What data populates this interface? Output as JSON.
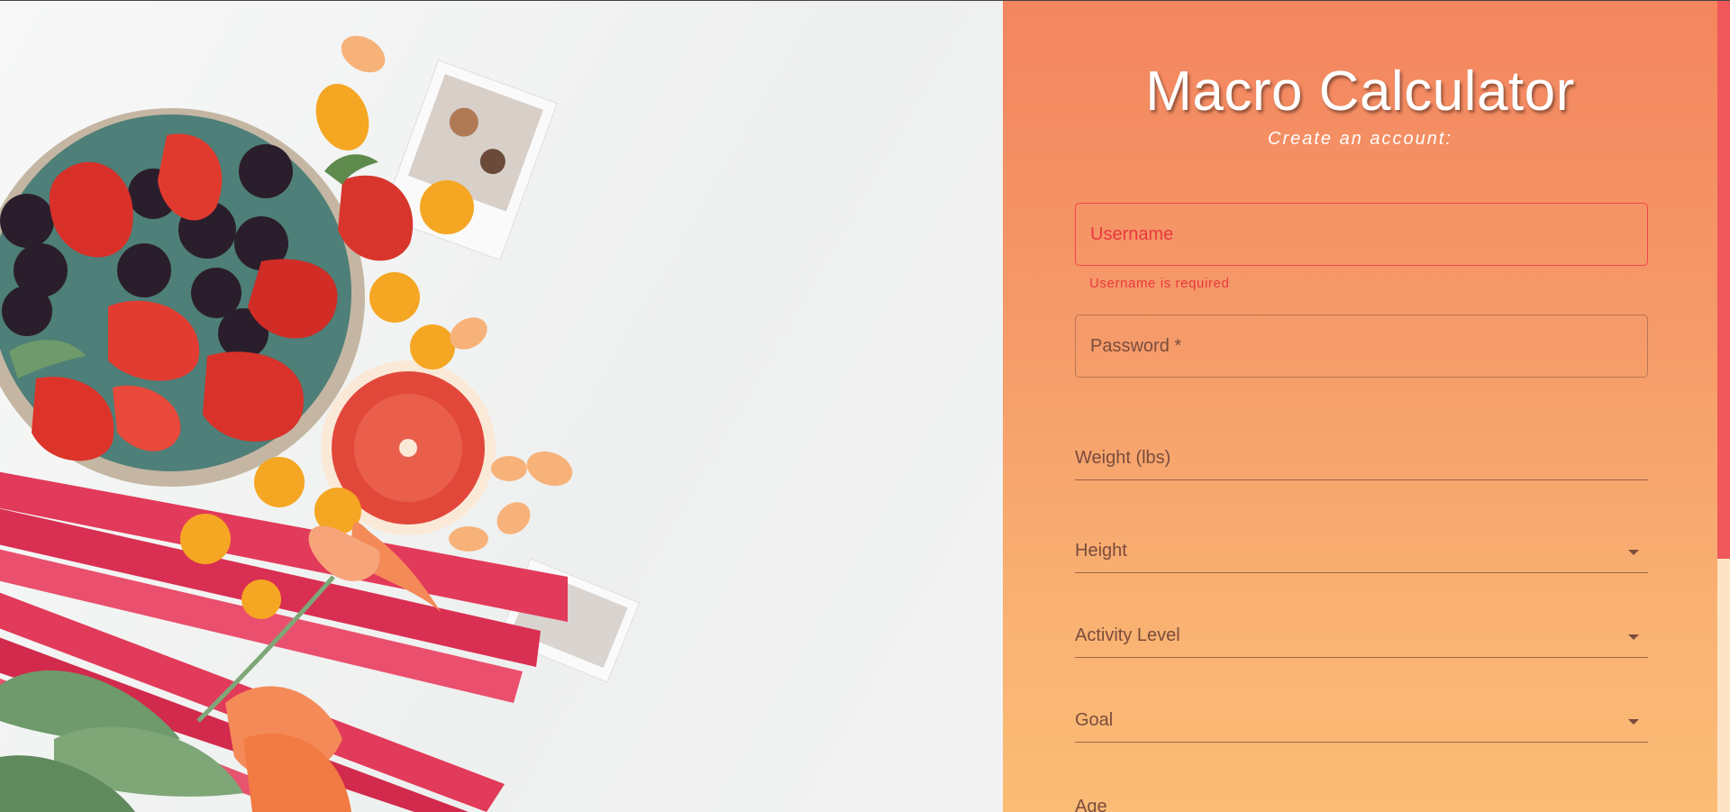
{
  "page": {
    "title": "Macro Calculator",
    "subtitle": "Create an account:"
  },
  "colors": {
    "panel_top": "#f4855f",
    "panel_bottom": "#fbbc76",
    "error": "#e8393f",
    "scroll_thumb": "#f0575a"
  },
  "form": {
    "username": {
      "label": "Username",
      "error": "Username is required",
      "state": "error"
    },
    "password": {
      "label": "Password *"
    },
    "weight": {
      "label": "Weight (lbs)"
    },
    "height": {
      "label": "Height",
      "icon": "chevron-down-icon"
    },
    "activity": {
      "label": "Activity Level",
      "icon": "chevron-down-icon"
    },
    "goal": {
      "label": "Goal",
      "icon": "chevron-down-icon"
    },
    "age": {
      "label": "Age"
    }
  }
}
